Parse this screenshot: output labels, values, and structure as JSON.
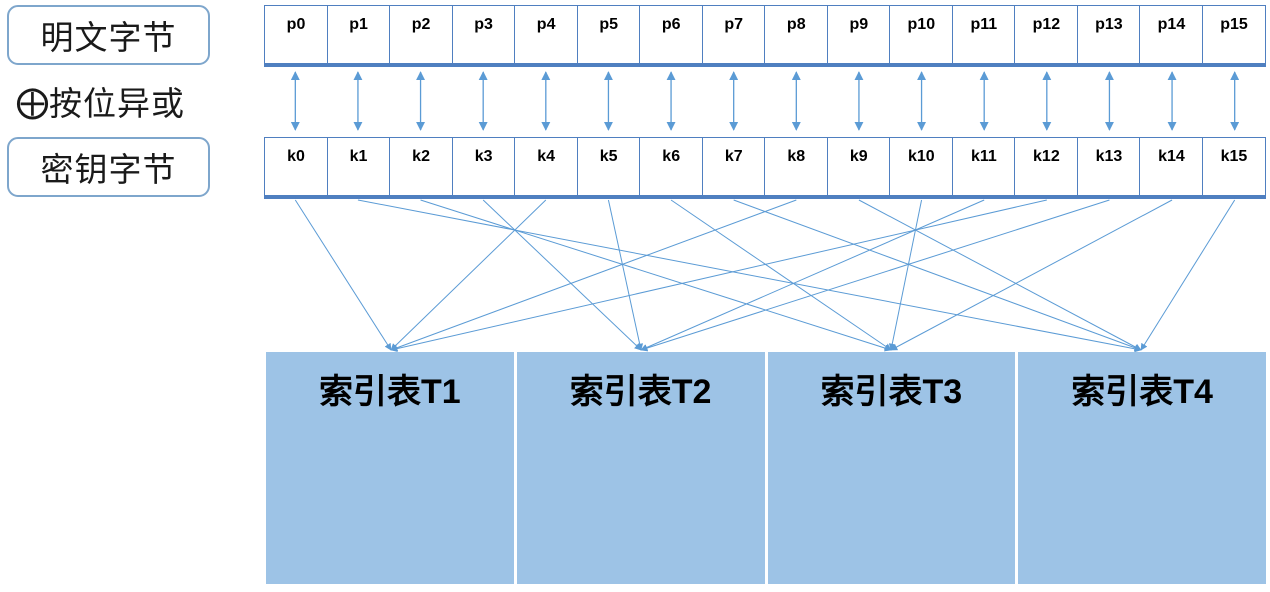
{
  "labels": {
    "plaintext": "明文字节",
    "xor_symbol": "⨁",
    "xor_text": "按位异或",
    "key": "密钥字节"
  },
  "plaintext_bytes": [
    "p0",
    "p1",
    "p2",
    "p3",
    "p4",
    "p5",
    "p6",
    "p7",
    "p8",
    "p9",
    "p10",
    "p11",
    "p12",
    "p13",
    "p14",
    "p15"
  ],
  "key_bytes": [
    "k0",
    "k1",
    "k2",
    "k3",
    "k4",
    "k5",
    "k6",
    "k7",
    "k8",
    "k9",
    "k10",
    "k11",
    "k12",
    "k13",
    "k14",
    "k15"
  ],
  "tables": [
    "索引表T1",
    "索引表T2",
    "索引表T3",
    "索引表T4"
  ],
  "key_to_table": [
    0,
    3,
    2,
    1,
    0,
    1,
    2,
    3,
    0,
    3,
    2,
    1,
    0,
    1,
    2,
    3
  ],
  "colors": {
    "border": "#4f7fc0",
    "arrow": "#5b9bd5",
    "table_fill": "#9dc3e6",
    "side_border": "#7ea6cc"
  }
}
